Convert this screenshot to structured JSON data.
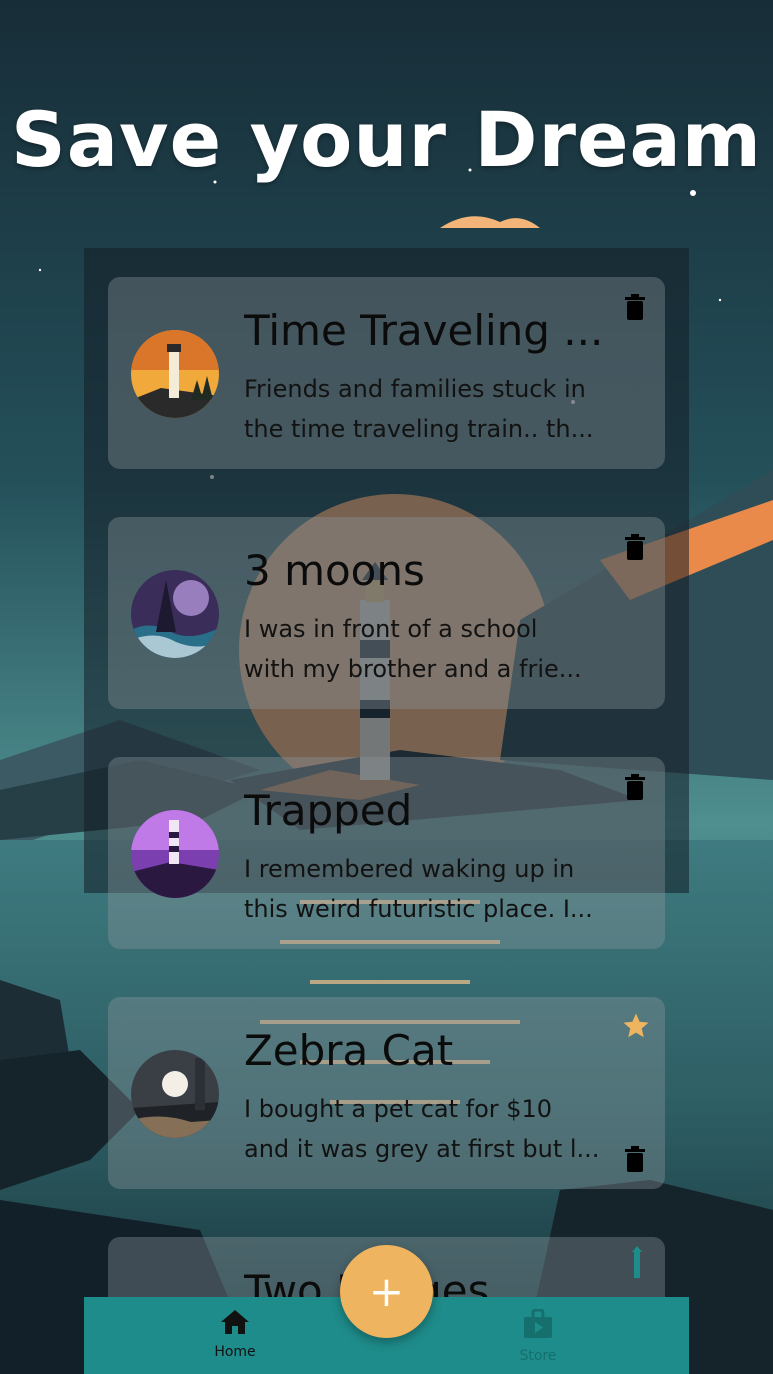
{
  "header": {
    "title": "Save your Dream"
  },
  "dreams": [
    {
      "title": "Time Traveling ...",
      "desc_lines": [
        "Friends and families stuck in",
        "the time traveling train.. th..."
      ],
      "starred": false
    },
    {
      "title": "3 moons",
      "desc_lines": [
        "I was in front of a school",
        "with my brother and a frie..."
      ],
      "starred": false
    },
    {
      "title": "Trapped",
      "desc_lines": [
        "I remembered waking up in",
        "this weird futuristic place. I..."
      ],
      "starred": false
    },
    {
      "title": "Zebra Cat",
      "desc_lines": [
        "I bought a pet cat for $10",
        "and it was grey at first but l..."
      ],
      "starred": true
    },
    {
      "title": "Two Images",
      "desc_lines": [],
      "starred": false
    }
  ],
  "fab": {
    "icon": "plus-icon",
    "label": "+"
  },
  "nav": {
    "items": [
      {
        "label": "Home",
        "icon": "home-icon",
        "active": true
      },
      {
        "label": "Store",
        "icon": "store-icon",
        "active": false
      }
    ]
  },
  "colors": {
    "accent": "#efb45f",
    "nav_bg": "#1e8c8a",
    "star": "#efb45f"
  }
}
